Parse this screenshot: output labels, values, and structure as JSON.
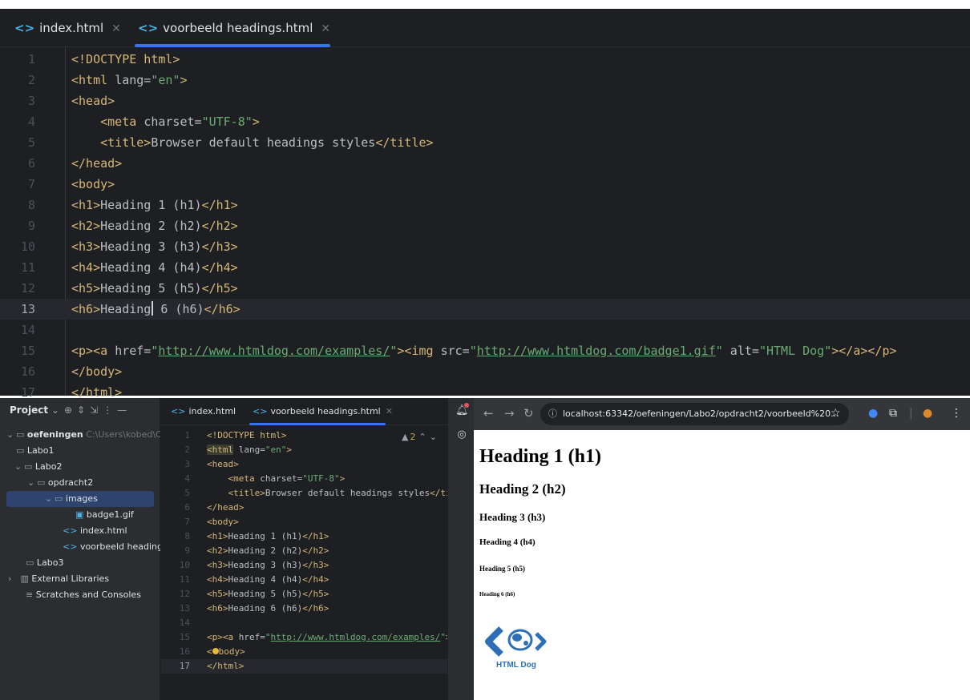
{
  "top_editor": {
    "tabs": [
      {
        "label": "index.html",
        "icon": "html-file-icon"
      },
      {
        "label": "voorbeeld headings.html",
        "icon": "html-file-icon",
        "active": true
      }
    ],
    "current_line": 13
  },
  "bottom_editor": {
    "project_panel": {
      "title": "Project",
      "tree": [
        {
          "label": "oefeningen",
          "path": "C:\\Users\\kobed\\C"
        },
        {
          "label": "Labo1"
        },
        {
          "label": "Labo2"
        },
        {
          "label": "opdracht2"
        },
        {
          "label": "images",
          "selected": true
        },
        {
          "label": "badge1.gif"
        },
        {
          "label": "index.html"
        },
        {
          "label": "voorbeeld headings.h"
        },
        {
          "label": "Labo3"
        },
        {
          "label": "External Libraries"
        },
        {
          "label": "Scratches and Consoles"
        }
      ]
    },
    "tabs": [
      {
        "label": "index.html"
      },
      {
        "label": "voorbeeld headings.html",
        "active": true
      }
    ],
    "warning_count": "2",
    "current_line": 17
  },
  "browser": {
    "address": "localhost:63342/oefeningen/Labo2/opdracht2/voorbeeld%20...",
    "headings": [
      "Heading 1 (h1)",
      "Heading 2 (h2)",
      "Heading 3 (h3)",
      "Heading 4 (h4)",
      "Heading 5 (h5)",
      "Heading 6 (h6)"
    ],
    "badge_label": "HTML Dog"
  },
  "colors": {
    "editor_bg": "#1e1f22",
    "tag": "#d5b778",
    "string": "#6aab73",
    "accent": "#3574f0"
  }
}
